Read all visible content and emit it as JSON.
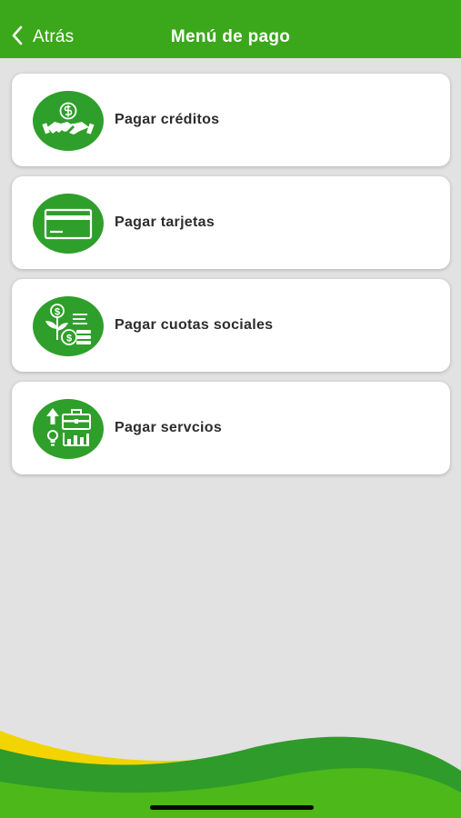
{
  "header": {
    "back_label": "Atrás",
    "back_icon": "chevron-left-icon",
    "title": "Menú de pago"
  },
  "menu": {
    "items": [
      {
        "label": "Pagar créditos",
        "icon": "handshake-dollar-icon"
      },
      {
        "label": "Pagar tarjetas",
        "icon": "credit-card-icon"
      },
      {
        "label": "Pagar cuotas sociales",
        "icon": "money-plant-coins-icon"
      },
      {
        "label": "Pagar servcios",
        "icon": "services-briefcase-chart-icon"
      }
    ]
  },
  "colors": {
    "header": "#3ba81b",
    "background": "#e2e2e2",
    "icon_circle": "#2f9f2b",
    "card": "#ffffff",
    "wave_dark_green": "#2f9b2b",
    "wave_light_green": "#4cb81a",
    "wave_yellow": "#f2d400"
  }
}
